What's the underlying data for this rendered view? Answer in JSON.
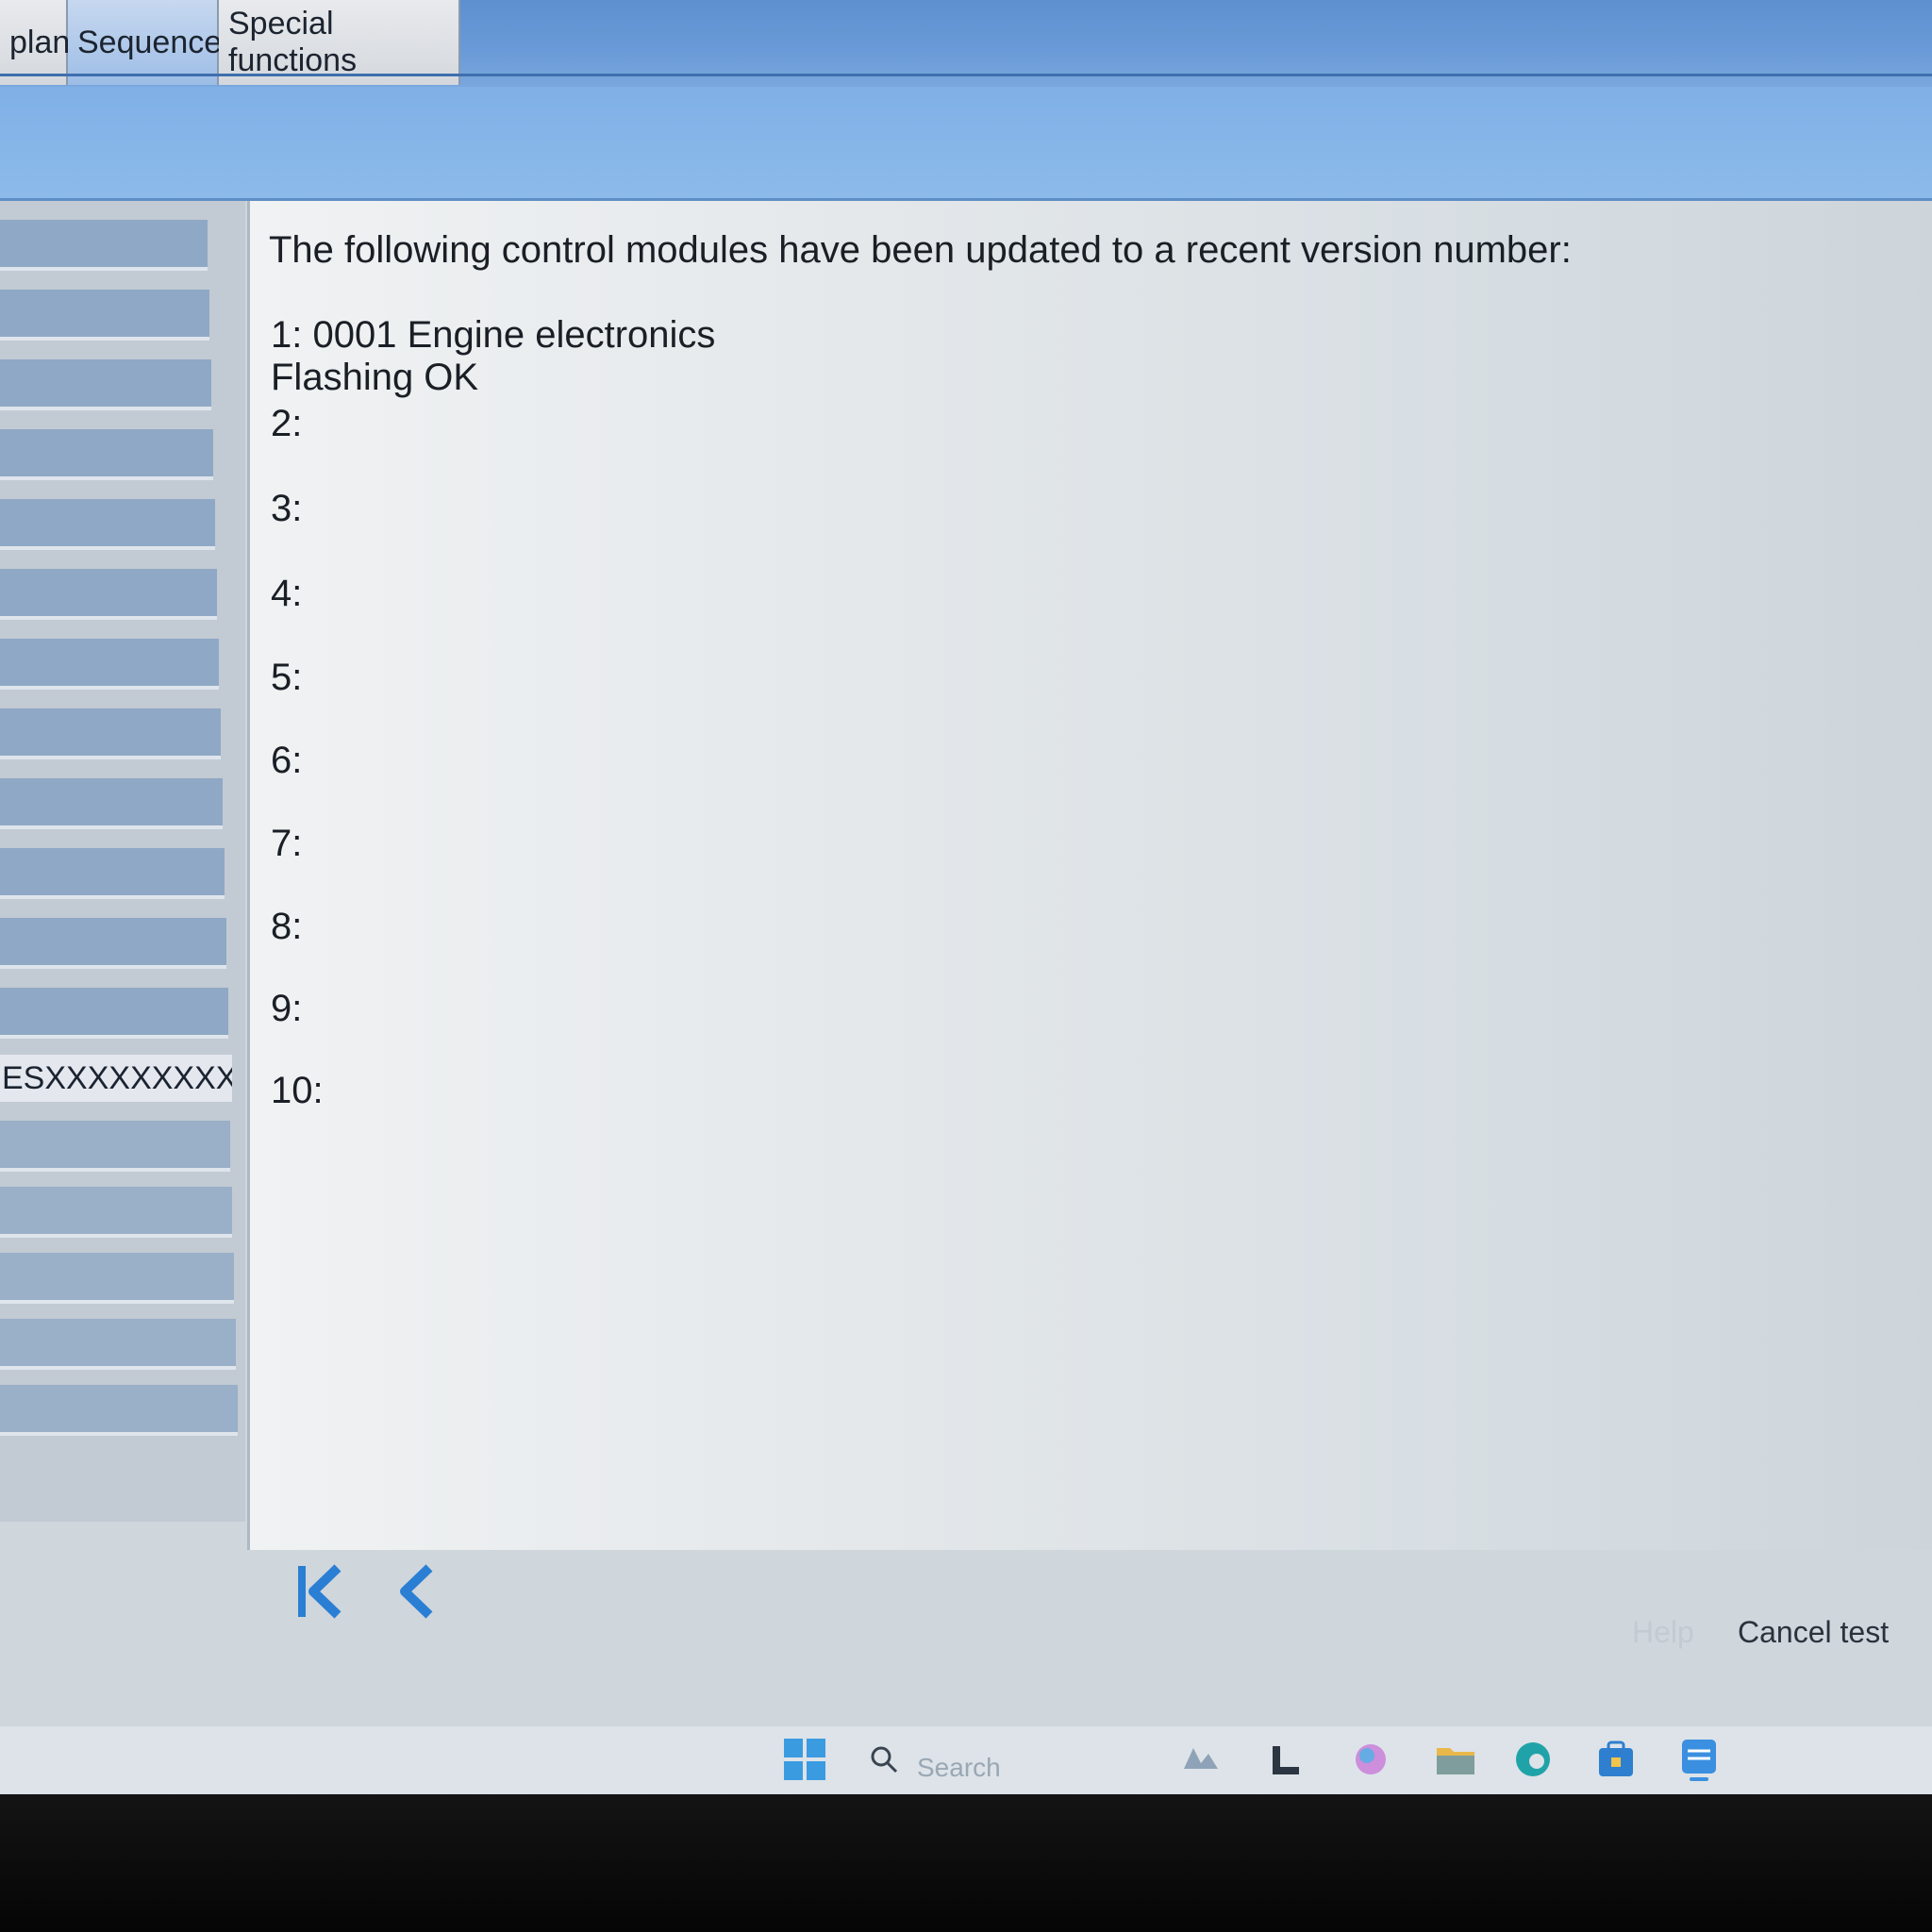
{
  "tabs": [
    {
      "label": "plan"
    },
    {
      "label": "Sequence"
    },
    {
      "label": "Special functions"
    }
  ],
  "sidebar": {
    "vehicle_id": "ESXXXXXXXXXXX"
  },
  "main": {
    "intro": "The following control modules have been updated to a recent version number:",
    "modules": [
      {
        "label": "1: 0001 Engine electronics",
        "status": "Flashing OK"
      },
      {
        "label": "2:"
      },
      {
        "label": "3:"
      },
      {
        "label": "4:"
      },
      {
        "label": "5:"
      },
      {
        "label": "6:"
      },
      {
        "label": "7:"
      },
      {
        "label": "8:"
      },
      {
        "label": "9:"
      },
      {
        "label": "10:"
      }
    ]
  },
  "nav": {
    "first_icon": "first-page-icon",
    "back_icon": "back-icon",
    "accent": "#2a7fd4"
  },
  "actions": {
    "help_label": "Help",
    "cancel_label": "Cancel test"
  },
  "taskbar": {
    "search_placeholder": "Search",
    "icons": [
      "windows-start-icon",
      "search-icon",
      "widgets-icon",
      "l-app-icon",
      "copilot-icon",
      "file-explorer-icon",
      "edge-icon",
      "store-icon",
      "app-icon"
    ]
  }
}
